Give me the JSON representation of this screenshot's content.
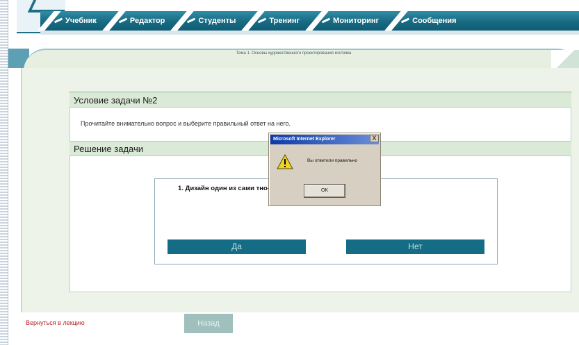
{
  "nav": {
    "items": [
      {
        "label": "Учебник"
      },
      {
        "label": "Редактор"
      },
      {
        "label": "Студенты"
      },
      {
        "label": "Тренинг"
      },
      {
        "label": "Мониторинг"
      },
      {
        "label": "Сообщения"
      }
    ]
  },
  "topic": {
    "title": "Тема 1. Основы художественного проектирования костюма"
  },
  "task": {
    "condition_header": "Условие задачи №2",
    "instruction": "Прочитайте внимательно вопрос и выберите правильный ответ на него.",
    "solution_header": "Решение задачи",
    "question_text": "1. Дизайн один из сами                                                    тно-художественной",
    "yes_label": "Да",
    "no_label": "Нет"
  },
  "footer": {
    "back_link": "Вернуться в лекцию",
    "back_button": "Назад"
  },
  "dialog": {
    "title": "Microsoft Internet Explorer",
    "close_glyph": "X",
    "message": "Вы ответили правильно",
    "ok_label": "OK"
  },
  "colors": {
    "nav_teal": "#186a82",
    "answer_button": "#156d85",
    "link_red": "#b6202a",
    "section_green": "#dbead6"
  }
}
